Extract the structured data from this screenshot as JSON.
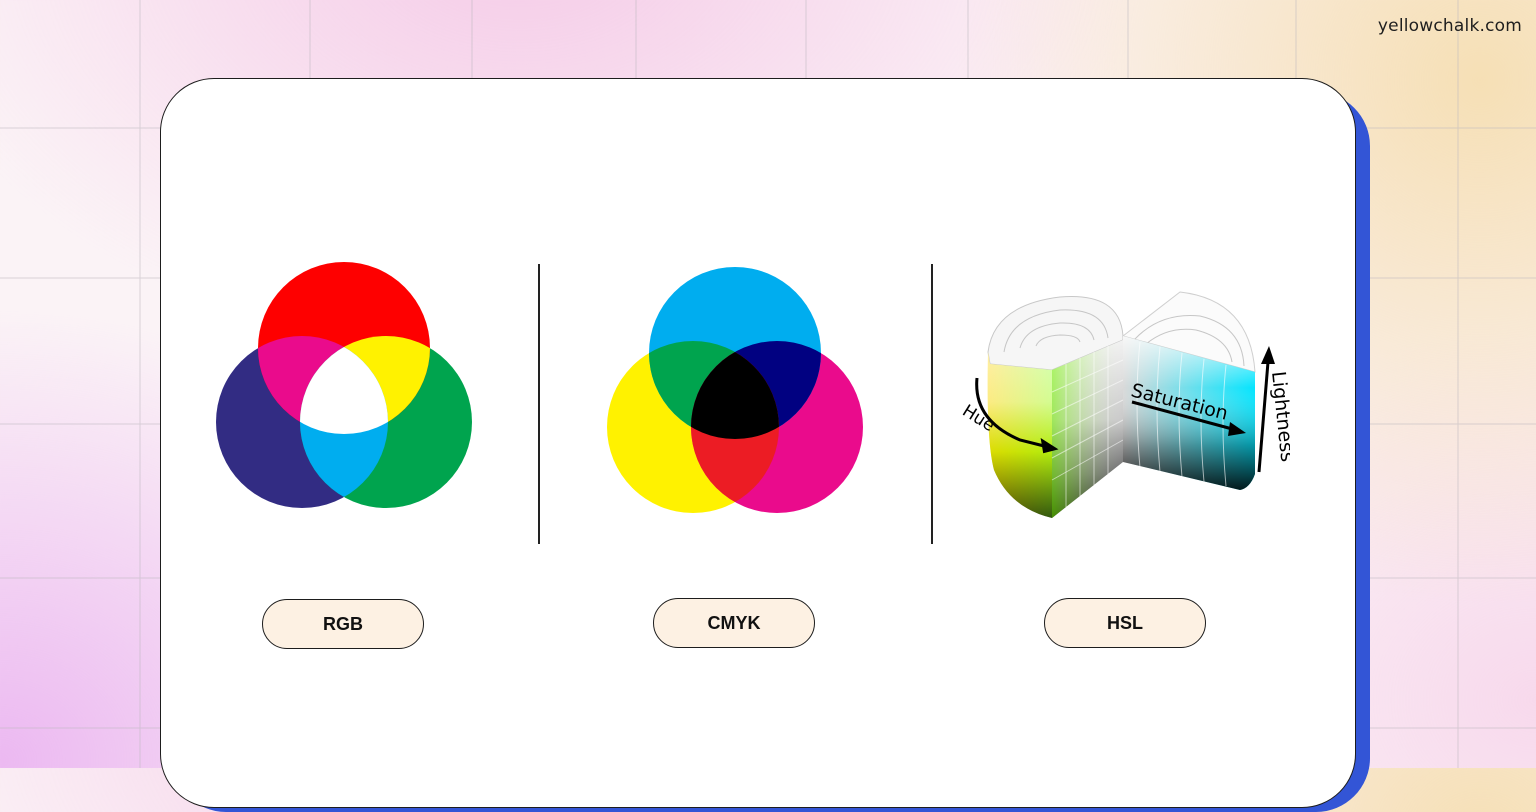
{
  "brand": "yellowchalk.com",
  "panels": [
    {
      "label": "RGB",
      "circles": [
        "red",
        "green",
        "blue"
      ]
    },
    {
      "label": "CMYK",
      "circles": [
        "cyan",
        "magenta",
        "yellow"
      ]
    },
    {
      "label": "HSL",
      "axes": {
        "hue": "Hue",
        "saturation": "Saturation",
        "lightness": "Lightness"
      }
    }
  ],
  "colors": {
    "card_accent": "#3355d6",
    "pill_fill": "#fdf1e3",
    "rgb_red": "#fe0000",
    "rgb_green": "#00a44e",
    "rgb_blue": "#322c83",
    "rgb_magenta": "#ea0b8c",
    "rgb_yellow": "#fff200",
    "rgb_cyan": "#00adef",
    "cmyk_cyan": "#00adef",
    "cmyk_magenta": "#ea0b8c",
    "cmyk_yellow": "#fff200",
    "cmyk_green": "#00a44e",
    "cmyk_blue": "#010181",
    "cmyk_red": "#ec1c24"
  }
}
